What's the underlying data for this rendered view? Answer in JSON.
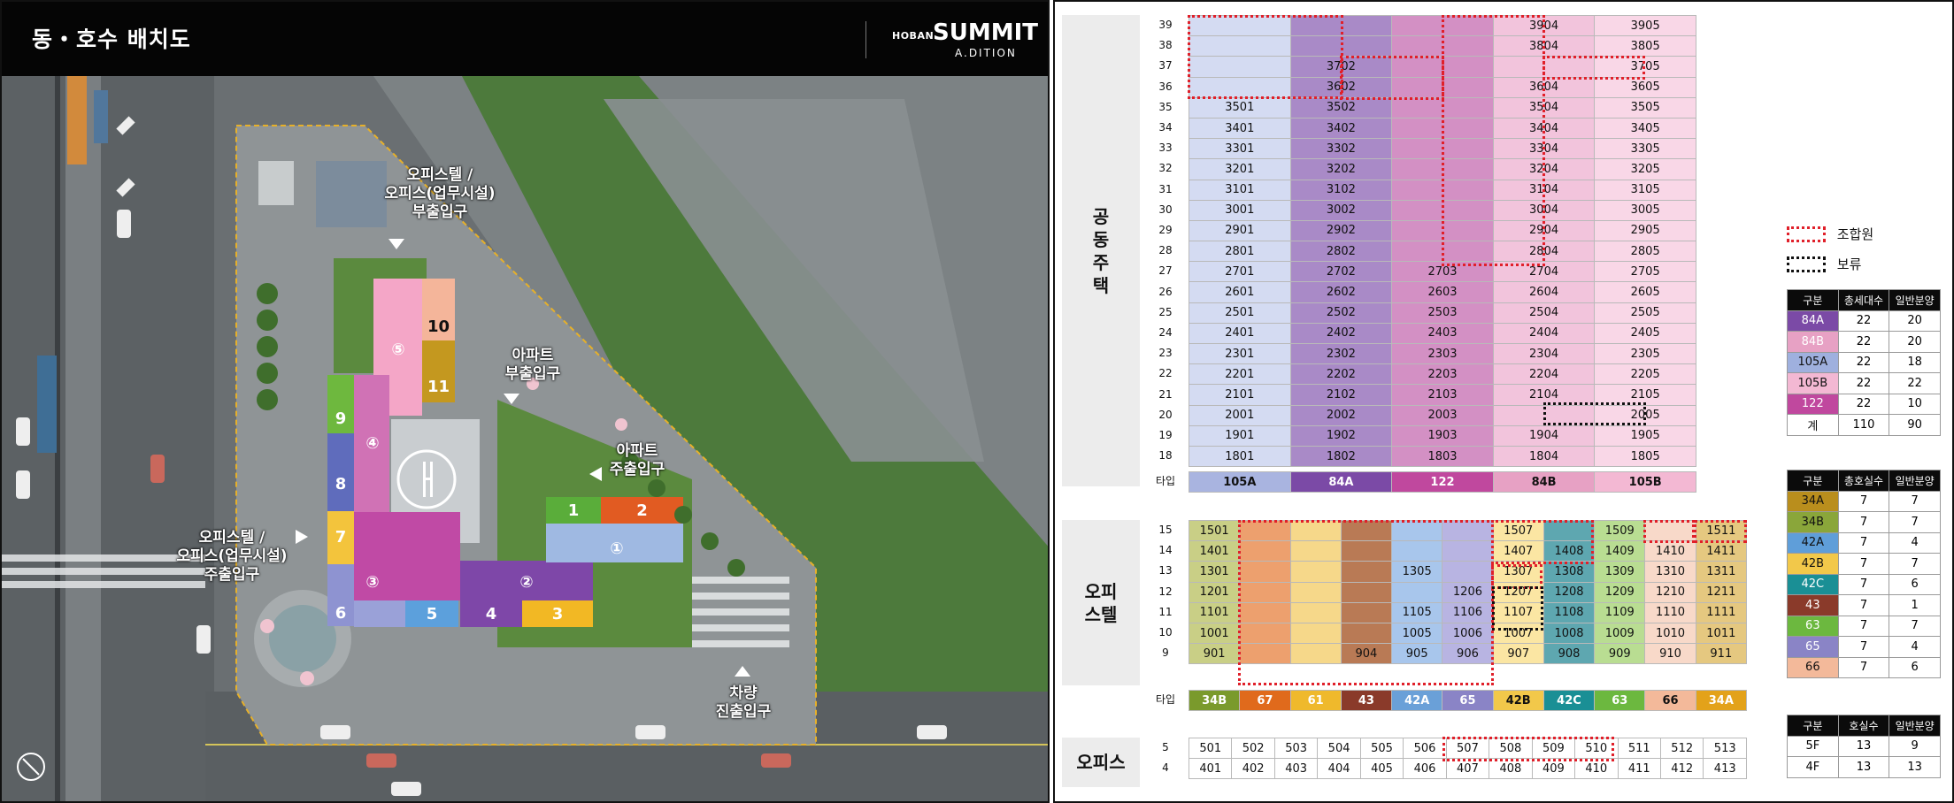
{
  "header": {
    "title": "동・호수 배치도",
    "brand_small": "HOBAN",
    "brand_main": "SUMMIT",
    "brand_sub": "A.DITION"
  },
  "map_labels": {
    "officetel_aux": "오피스텔 /\n오피스(업무시설)\n부출입구",
    "apt_aux": "아파트\n부출입구",
    "apt_main": "아파트\n주출입구",
    "officetel_main": "오피스텔 /\n오피스(업무시설)\n주출입구",
    "car": "차량\n진출입구"
  },
  "buildings": [
    "1",
    "2",
    "3",
    "4",
    "5",
    "6",
    "7",
    "8",
    "9",
    "10",
    "11"
  ],
  "circled": [
    "①",
    "②",
    "③",
    "④",
    "⑤"
  ],
  "apt": {
    "section_label": "공\n동\n주\n택",
    "type_row_label": "타입",
    "floors": [
      "39",
      "38",
      "37",
      "36",
      "35",
      "34",
      "33",
      "32",
      "31",
      "30",
      "29",
      "28",
      "27",
      "26",
      "25",
      "24",
      "23",
      "22",
      "21",
      "20",
      "19",
      "18"
    ],
    "rows": [
      [
        "",
        "",
        "",
        "3904",
        "3905"
      ],
      [
        "",
        "",
        "",
        "3804",
        "3805"
      ],
      [
        "",
        "3702",
        "",
        "",
        "3705"
      ],
      [
        "",
        "3602",
        "",
        "3604",
        "3605"
      ],
      [
        "3501",
        "3502",
        "",
        "3504",
        "3505"
      ],
      [
        "3401",
        "3402",
        "",
        "3404",
        "3405"
      ],
      [
        "3301",
        "3302",
        "",
        "3304",
        "3305"
      ],
      [
        "3201",
        "3202",
        "",
        "3204",
        "3205"
      ],
      [
        "3101",
        "3102",
        "",
        "3104",
        "3105"
      ],
      [
        "3001",
        "3002",
        "",
        "3004",
        "3005"
      ],
      [
        "2901",
        "2902",
        "",
        "2904",
        "2905"
      ],
      [
        "2801",
        "2802",
        "",
        "2804",
        "2805"
      ],
      [
        "2701",
        "2702",
        "2703",
        "2704",
        "2705"
      ],
      [
        "2601",
        "2602",
        "2603",
        "2604",
        "2605"
      ],
      [
        "2501",
        "2502",
        "2503",
        "2504",
        "2505"
      ],
      [
        "2401",
        "2402",
        "2403",
        "2404",
        "2405"
      ],
      [
        "2301",
        "2302",
        "2303",
        "2304",
        "2305"
      ],
      [
        "2201",
        "2202",
        "2203",
        "2204",
        "2205"
      ],
      [
        "2101",
        "2102",
        "2103",
        "2104",
        "2105"
      ],
      [
        "2001",
        "2002",
        "2003",
        "",
        "2005"
      ],
      [
        "1901",
        "1902",
        "1903",
        "1904",
        "1905"
      ],
      [
        "1801",
        "1802",
        "1803",
        "1804",
        "1805"
      ]
    ],
    "types": [
      "105A",
      "84A",
      "122",
      "84B",
      "105B"
    ],
    "type_colors": [
      "#a9b4e0",
      "#7b4aa6",
      "#c0489e",
      "#e7a1c4",
      "#f3b8d3"
    ],
    "col_bg": [
      "#d4dbf2",
      "#a98ac7",
      "#d390c4",
      "#f2c4dc",
      "#f9d7e7"
    ]
  },
  "ofs": {
    "section_label": "오피\n스텔",
    "type_row_label": "타입",
    "floors": [
      "15",
      "14",
      "13",
      "12",
      "11",
      "10",
      "9"
    ],
    "rows": [
      [
        "1501",
        "",
        "",
        "",
        "",
        "",
        "1507",
        "",
        "1509",
        "",
        "1511"
      ],
      [
        "1401",
        "",
        "",
        "",
        "",
        "",
        "1407",
        "1408",
        "1409",
        "1410",
        "1411"
      ],
      [
        "1301",
        "",
        "",
        "",
        "1305",
        "",
        "1307",
        "1308",
        "1309",
        "1310",
        "1311"
      ],
      [
        "1201",
        "",
        "",
        "",
        "",
        "1206",
        "1207",
        "1208",
        "1209",
        "1210",
        "1211"
      ],
      [
        "1101",
        "",
        "",
        "",
        "1105",
        "1106",
        "1107",
        "1108",
        "1109",
        "1110",
        "1111"
      ],
      [
        "1001",
        "",
        "",
        "",
        "1005",
        "1006",
        "1007",
        "1008",
        "1009",
        "1010",
        "1011"
      ],
      [
        "901",
        "",
        "",
        "904",
        "905",
        "906",
        "907",
        "908",
        "909",
        "910",
        "911"
      ]
    ],
    "types": [
      "34B",
      "67",
      "61",
      "43",
      "42A",
      "65",
      "42B",
      "42C",
      "63",
      "66",
      "34A"
    ],
    "type_colors": [
      "#7a9a2c",
      "#e06a1c",
      "#efb92c",
      "#8a3a2a",
      "#6aa0d8",
      "#8a84c6",
      "#f2c84a",
      "#1a8f95",
      "#6cb83f",
      "#f3b99a",
      "#e3a21a"
    ],
    "col_bg": [
      "#c9cf86",
      "#eda06e",
      "#f6d88a",
      "#b97a55",
      "#a8c6ec",
      "#b8b4e2",
      "#fbe6a3",
      "#5ea7b0",
      "#b9dd92",
      "#f8d9c9",
      "#e5c880"
    ]
  },
  "office": {
    "section_label": "오피스",
    "floors": [
      "5",
      "4"
    ],
    "rows": [
      [
        "501",
        "502",
        "503",
        "504",
        "505",
        "506",
        "507",
        "508",
        "509",
        "510",
        "511",
        "512",
        "513"
      ],
      [
        "401",
        "402",
        "403",
        "404",
        "405",
        "406",
        "407",
        "408",
        "409",
        "410",
        "411",
        "412",
        "413"
      ]
    ]
  },
  "legend": {
    "union": "조합원",
    "reserved": "보류"
  },
  "sum_apt": {
    "headers": [
      "구분",
      "총세대수",
      "일반분양"
    ],
    "rows": [
      [
        "84A",
        "22",
        "20"
      ],
      [
        "84B",
        "22",
        "20"
      ],
      [
        "105A",
        "22",
        "18"
      ],
      [
        "105B",
        "22",
        "22"
      ],
      [
        "122",
        "22",
        "10"
      ],
      [
        "계",
        "110",
        "90"
      ]
    ],
    "colors": [
      "#7b4aa6",
      "#e7a1c4",
      "#9fb0de",
      "#f3b8d3",
      "#c0489e",
      "#ffffff"
    ],
    "text_colors": [
      "#fff",
      "#fff",
      "#111",
      "#111",
      "#fff",
      "#111"
    ]
  },
  "sum_ofs": {
    "headers": [
      "구분",
      "총호실수",
      "일반분양"
    ],
    "rows": [
      [
        "34A",
        "7",
        "7"
      ],
      [
        "34B",
        "7",
        "7"
      ],
      [
        "42A",
        "7",
        "4"
      ],
      [
        "42B",
        "7",
        "7"
      ],
      [
        "42C",
        "7",
        "6"
      ],
      [
        "43",
        "7",
        "1"
      ],
      [
        "63",
        "7",
        "7"
      ],
      [
        "65",
        "7",
        "4"
      ],
      [
        "66",
        "7",
        "6"
      ]
    ],
    "colors": [
      "#b98e1d",
      "#8aa63a",
      "#5f9ed9",
      "#f2c84a",
      "#1a8f95",
      "#8a3a2a",
      "#6cb83f",
      "#8a84c6",
      "#f3b99a"
    ],
    "text_colors": [
      "#111",
      "#111",
      "#111",
      "#111",
      "#fff",
      "#fff",
      "#fff",
      "#fff",
      "#111"
    ]
  },
  "sum_office": {
    "headers": [
      "구분",
      "호실수",
      "일반분양"
    ],
    "rows": [
      [
        "5F",
        "13",
        "9"
      ],
      [
        "4F",
        "13",
        "13"
      ]
    ]
  }
}
